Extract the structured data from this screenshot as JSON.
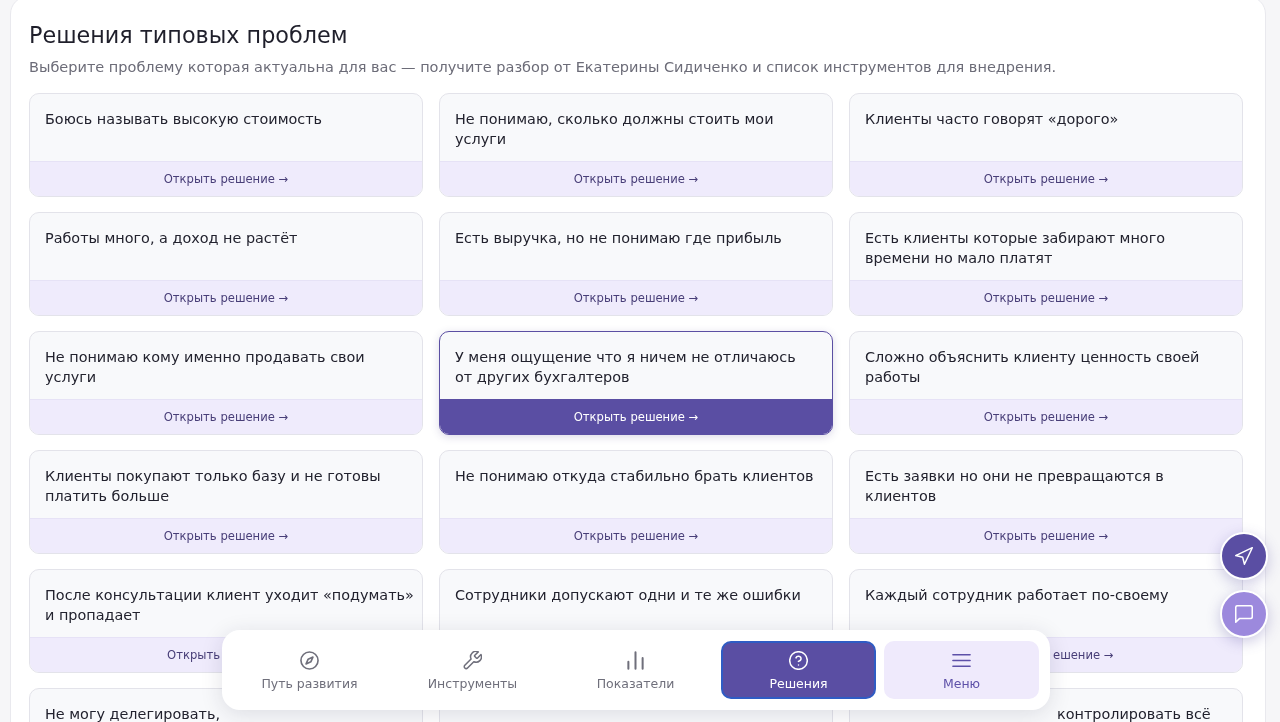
{
  "page": {
    "title": "Решения типовых проблем",
    "subtitle": "Выберите проблему которая актуальна для вас — получите разбор от Екатерины Сидиченко и список инструментов для внедрения."
  },
  "cards": [
    {
      "title": "Боюсь называть высокую стоимость",
      "action": "Открыть решение →",
      "selected": false
    },
    {
      "title": "Не понимаю, сколько должны стоить мои\nуслуги",
      "action": "Открыть решение →",
      "selected": false
    },
    {
      "title": "Клиенты часто говорят «дорого»",
      "action": "Открыть решение →",
      "selected": false
    },
    {
      "title": "Работы много, а доход не растёт",
      "action": "Открыть решение →",
      "selected": false
    },
    {
      "title": "Есть выручка, но не понимаю где прибыль",
      "action": "Открыть решение →",
      "selected": false
    },
    {
      "title": "Есть клиенты которые забирают много\nвремени но мало платят",
      "action": "Открыть решение →",
      "selected": false
    },
    {
      "title": "Не понимаю кому именно продавать свои\nуслуги",
      "action": "Открыть решение →",
      "selected": false
    },
    {
      "title": "У меня ощущение что я ничем не отличаюсь\nот других бухгалтеров",
      "action": "Открыть решение →",
      "selected": true
    },
    {
      "title": "Сложно объяснить клиенту ценность своей\nработы",
      "action": "Открыть решение →",
      "selected": false
    },
    {
      "title": "Клиенты покупают только базу и не готовы\nплатить больше",
      "action": "Открыть решение →",
      "selected": false
    },
    {
      "title": "Не понимаю откуда стабильно брать клиентов",
      "action": "Открыть решение →",
      "selected": false
    },
    {
      "title": "Есть заявки но они не превращаются в\nклиентов",
      "action": "Открыть решение →",
      "selected": false
    },
    {
      "title": "После консультации клиент уходит «подумать»\nи пропадает",
      "action": "Открыть",
      "selected": false
    },
    {
      "title": "Сотрудники допускают одни и те же ошибки",
      "selected": false
    },
    {
      "title": "Каждый сотрудник работает по-своему",
      "action": "ешение →",
      "selected": false
    },
    {
      "title": "Не могу делегировать,",
      "selected": false
    },
    {
      "selected": false
    },
    {
      "title": "контролировать всё",
      "selected": false
    }
  ],
  "bottom_nav": [
    {
      "label": "Путь развития",
      "kind": "tab",
      "selected": false
    },
    {
      "label": "Инструменты",
      "kind": "tab",
      "selected": false
    },
    {
      "label": "Показатели",
      "kind": "tab",
      "selected": false
    },
    {
      "label": "Решения",
      "kind": "tab",
      "selected": true
    },
    {
      "label": "Меню",
      "kind": "menu",
      "selected": false
    }
  ]
}
